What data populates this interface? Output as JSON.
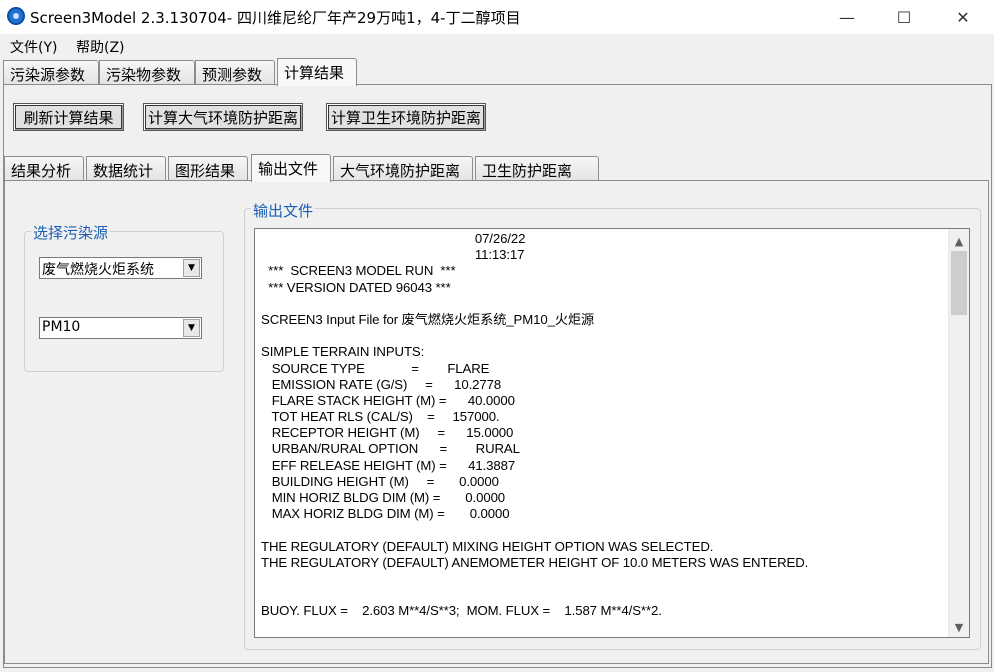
{
  "window": {
    "title": "Screen3Model 2.3.130704- 四川维尼纶厂年产29万吨1，4-丁二醇项目",
    "minimize": "—",
    "maximize": "☐",
    "close": "✕"
  },
  "menu": [
    "文件(Y)",
    "帮助(Z)"
  ],
  "main_tabs": [
    "污染源参数",
    "污染物参数",
    "预测参数",
    "计算结果"
  ],
  "main_tab_active": "计算结果",
  "actions": [
    "刷新计算结果",
    "计算大气环境防护距离",
    "计算卫生环境防护距离"
  ],
  "sub_tabs": [
    "结果分析",
    "数据统计",
    "图形结果",
    "输出文件",
    "大气环境防护距离",
    "卫生防护距离"
  ],
  "sub_tab_active": "输出文件",
  "source_group": {
    "legend": "选择污染源",
    "source_select": "废气燃烧火炬系统",
    "pollutant_select": "PM10"
  },
  "output": {
    "legend": "输出文件",
    "lines": [
      "                                                            07/26/22",
      "                                                            11:13:17",
      "  ***  SCREEN3 MODEL RUN  ***",
      "  *** VERSION DATED 96043 ***",
      "",
      "SCREEN3 Input File for 废气燃烧火炬系统_PM10_火炬源",
      "",
      "SIMPLE TERRAIN INPUTS:",
      "   SOURCE TYPE             =        FLARE",
      "   EMISSION RATE (G/S)     =      10.2778",
      "   FLARE STACK HEIGHT (M) =      40.0000",
      "   TOT HEAT RLS (CAL/S)    =     157000.",
      "   RECEPTOR HEIGHT (M)     =      15.0000",
      "   URBAN/RURAL OPTION      =        RURAL",
      "   EFF RELEASE HEIGHT (M) =      41.3887",
      "   BUILDING HEIGHT (M)     =       0.0000",
      "   MIN HORIZ BLDG DIM (M) =       0.0000",
      "   MAX HORIZ BLDG DIM (M) =       0.0000",
      "",
      "THE REGULATORY (DEFAULT) MIXING HEIGHT OPTION WAS SELECTED.",
      "THE REGULATORY (DEFAULT) ANEMOMETER HEIGHT OF 10.0 METERS WAS ENTERED.",
      "",
      "",
      "BUOY. FLUX =    2.603 M**4/S**3;  MOM. FLUX =    1.587 M**4/S**2."
    ]
  },
  "icons": {
    "scroll_up": "▲",
    "scroll_down": "▼",
    "dropdown": "▼"
  }
}
